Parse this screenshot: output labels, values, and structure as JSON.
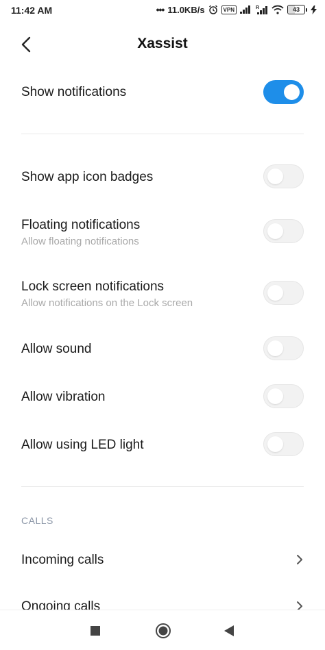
{
  "status_bar": {
    "time": "11:42 AM",
    "network_speed": "11.0KB/s",
    "vpn_label": "VPN",
    "battery_level": "43"
  },
  "header": {
    "title": "Xassist"
  },
  "settings": {
    "show_notifications": {
      "label": "Show notifications",
      "enabled": true
    },
    "app_icon_badges": {
      "label": "Show app icon badges",
      "enabled": false
    },
    "floating_notifications": {
      "label": "Floating notifications",
      "sub": "Allow floating notifications",
      "enabled": false
    },
    "lock_screen_notifications": {
      "label": "Lock screen notifications",
      "sub": "Allow notifications on the Lock screen",
      "enabled": false
    },
    "allow_sound": {
      "label": "Allow sound",
      "enabled": false
    },
    "allow_vibration": {
      "label": "Allow vibration",
      "enabled": false
    },
    "allow_led": {
      "label": "Allow using LED light",
      "enabled": false
    }
  },
  "calls_section": {
    "header": "CALLS",
    "items": [
      {
        "label": "Incoming calls"
      },
      {
        "label": "Ongoing calls"
      }
    ]
  },
  "colors": {
    "accent": "#1e8ee9",
    "toggle_off": "#f2f2f2",
    "subtext": "#a8a8a8",
    "section_header": "#8a95a6"
  },
  "icons": [
    "back-arrow-icon",
    "chevron-right-icon",
    "recents-square-icon",
    "home-circle-icon",
    "back-triangle-icon"
  ]
}
